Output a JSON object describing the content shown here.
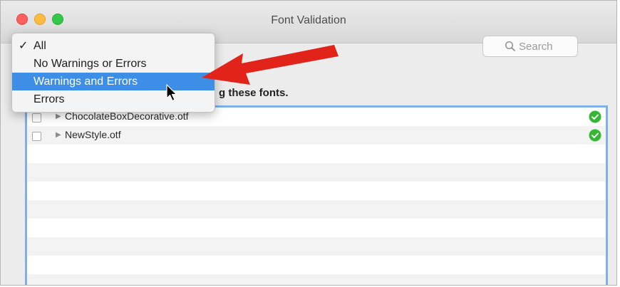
{
  "window": {
    "title": "Font Validation"
  },
  "search": {
    "placeholder": "Search"
  },
  "header": {
    "text_fragment": "g these fonts."
  },
  "filter_menu": {
    "items": [
      {
        "label": "All",
        "checked": true
      },
      {
        "label": "No Warnings or Errors",
        "checked": false
      },
      {
        "label": "Warnings and Errors",
        "checked": false,
        "highlighted": true
      },
      {
        "label": "Errors",
        "checked": false
      }
    ],
    "check_glyph": "✓"
  },
  "fonts": [
    {
      "name": "ChocolateBoxDecorative.otf",
      "status": "passed"
    },
    {
      "name": "NewStyle.otf",
      "status": "passed"
    }
  ],
  "colors": {
    "selection": "#3d8ee6",
    "ok_badge": "#35b736",
    "annotation_arrow": "#e2231a",
    "list_focus_ring": "#7fb0e8"
  },
  "icons": {
    "status_ok": "checkmark-circle-icon",
    "search": "magnifier-icon",
    "disclosure": "disclosure-triangle-icon"
  }
}
